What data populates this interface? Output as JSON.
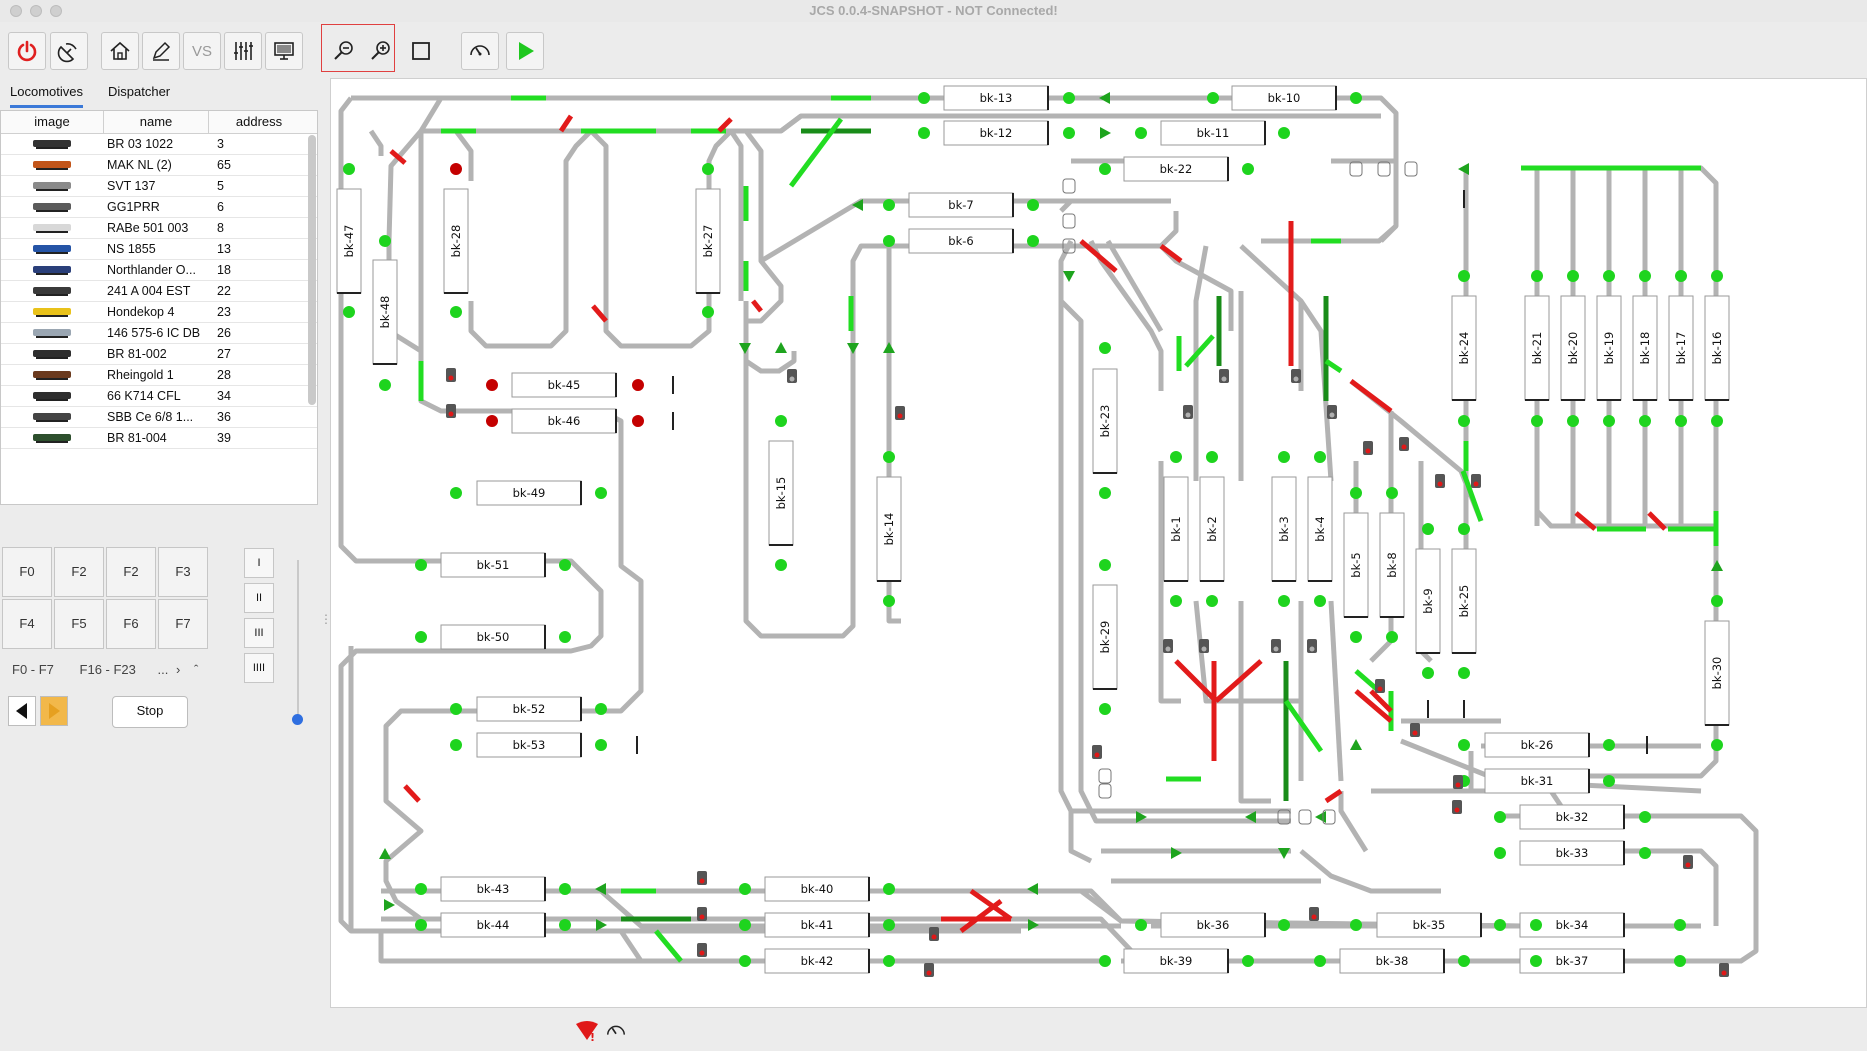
{
  "window": {
    "title": "JCS 0.0.4-SNAPSHOT - NOT Connected!"
  },
  "toolbar": {
    "buttons": [
      {
        "icon": "power-icon"
      },
      {
        "icon": "disconnect-icon"
      },
      {
        "icon": "home-icon"
      },
      {
        "icon": "edit-icon"
      },
      {
        "icon": "vs-icon",
        "label": "VS"
      },
      {
        "icon": "settings-sliders-icon"
      },
      {
        "icon": "monitor-icon"
      },
      {
        "icon": "zoom-out-icon"
      },
      {
        "icon": "zoom-in-icon"
      },
      {
        "icon": "stop-square-icon"
      },
      {
        "icon": "autopilot-icon"
      },
      {
        "icon": "play-icon"
      }
    ]
  },
  "tabs": {
    "locomotives": "Locomotives",
    "dispatcher": "Dispatcher"
  },
  "loco_table": {
    "headers": {
      "image": "image",
      "name": "name",
      "address": "address"
    },
    "rows": [
      {
        "name": "BR 03 1022",
        "address": "3"
      },
      {
        "name": "MAK NL (2)",
        "address": "65"
      },
      {
        "name": "SVT 137",
        "address": "5"
      },
      {
        "name": "GG1PRR",
        "address": "6"
      },
      {
        "name": " RABe 501 003",
        "address": "8"
      },
      {
        "name": "NS 1855",
        "address": "13"
      },
      {
        "name": "Northlander O...",
        "address": "18"
      },
      {
        "name": "241 A 004 EST",
        "address": "22"
      },
      {
        "name": "Hondekop 4",
        "address": "23"
      },
      {
        "name": "146 575-6 IC DB",
        "address": "26"
      },
      {
        "name": "BR 81-002",
        "address": "27"
      },
      {
        "name": "Rheingold 1",
        "address": "28"
      },
      {
        "name": "66 K714 CFL",
        "address": "34"
      },
      {
        "name": "SBB Ce 6/8 1...",
        "address": "36"
      },
      {
        "name": "BR 81-004",
        "address": "39"
      }
    ]
  },
  "function_keys": {
    "keys": [
      "F0",
      "F2",
      "F2",
      "F3",
      "F4",
      "F5",
      "F6",
      "F7"
    ],
    "groups": [
      "F0 - F7",
      "F16 - F23",
      "..."
    ],
    "cab_buttons": [
      "I",
      "II",
      "III",
      "IIII"
    ]
  },
  "controls": {
    "stop_label": "Stop"
  },
  "colors": {
    "track": "#b3b3b3",
    "occupied_green": "#22dd22",
    "route_green": "#2aeb2a",
    "dark_green": "#198c19",
    "red": "#e21b1b",
    "sensor_on": "#1ed41e",
    "sensor_red": "#c40000",
    "accent": "#3b79d8"
  },
  "blocks": {
    "bk13": "bk-13",
    "bk10": "bk-10",
    "bk12": "bk-12",
    "bk11": "bk-11",
    "bk22": "bk-22",
    "bk7": "bk-7",
    "bk6": "bk-6",
    "bk47": "bk-47",
    "bk48": "bk-48",
    "bk28": "bk-28",
    "bk27": "bk-27",
    "bk45": "bk-45",
    "bk46": "bk-46",
    "bk49": "bk-49",
    "bk51": "bk-51",
    "bk50": "bk-50",
    "bk52": "bk-52",
    "bk53": "bk-53",
    "bk43": "bk-43",
    "bk44": "bk-44",
    "bk40": "bk-40",
    "bk41": "bk-41",
    "bk42": "bk-42",
    "bk15": "bk-15",
    "bk14": "bk-14",
    "bk23": "bk-23",
    "bk29": "bk-29",
    "bk1": "bk-1",
    "bk2": "bk-2",
    "bk3": "bk-3",
    "bk4": "bk-4",
    "bk5": "bk-5",
    "bk8": "bk-8",
    "bk9": "bk-9",
    "bk25": "bk-25",
    "bk24": "bk-24",
    "bk21": "bk-21",
    "bk20": "bk-20",
    "bk19": "bk-19",
    "bk18": "bk-18",
    "bk17": "bk-17",
    "bk16": "bk-16",
    "bk30": "bk-30",
    "bk26": "bk-26",
    "bk31": "bk-31",
    "bk32": "bk-32",
    "bk33": "bk-33",
    "bk36": "bk-36",
    "bk35": "bk-35",
    "bk34": "bk-34",
    "bk39": "bk-39",
    "bk38": "bk-38",
    "bk37": "bk-37"
  },
  "statusbar": {
    "icons": [
      "alert-icon",
      "speed-icon"
    ]
  }
}
